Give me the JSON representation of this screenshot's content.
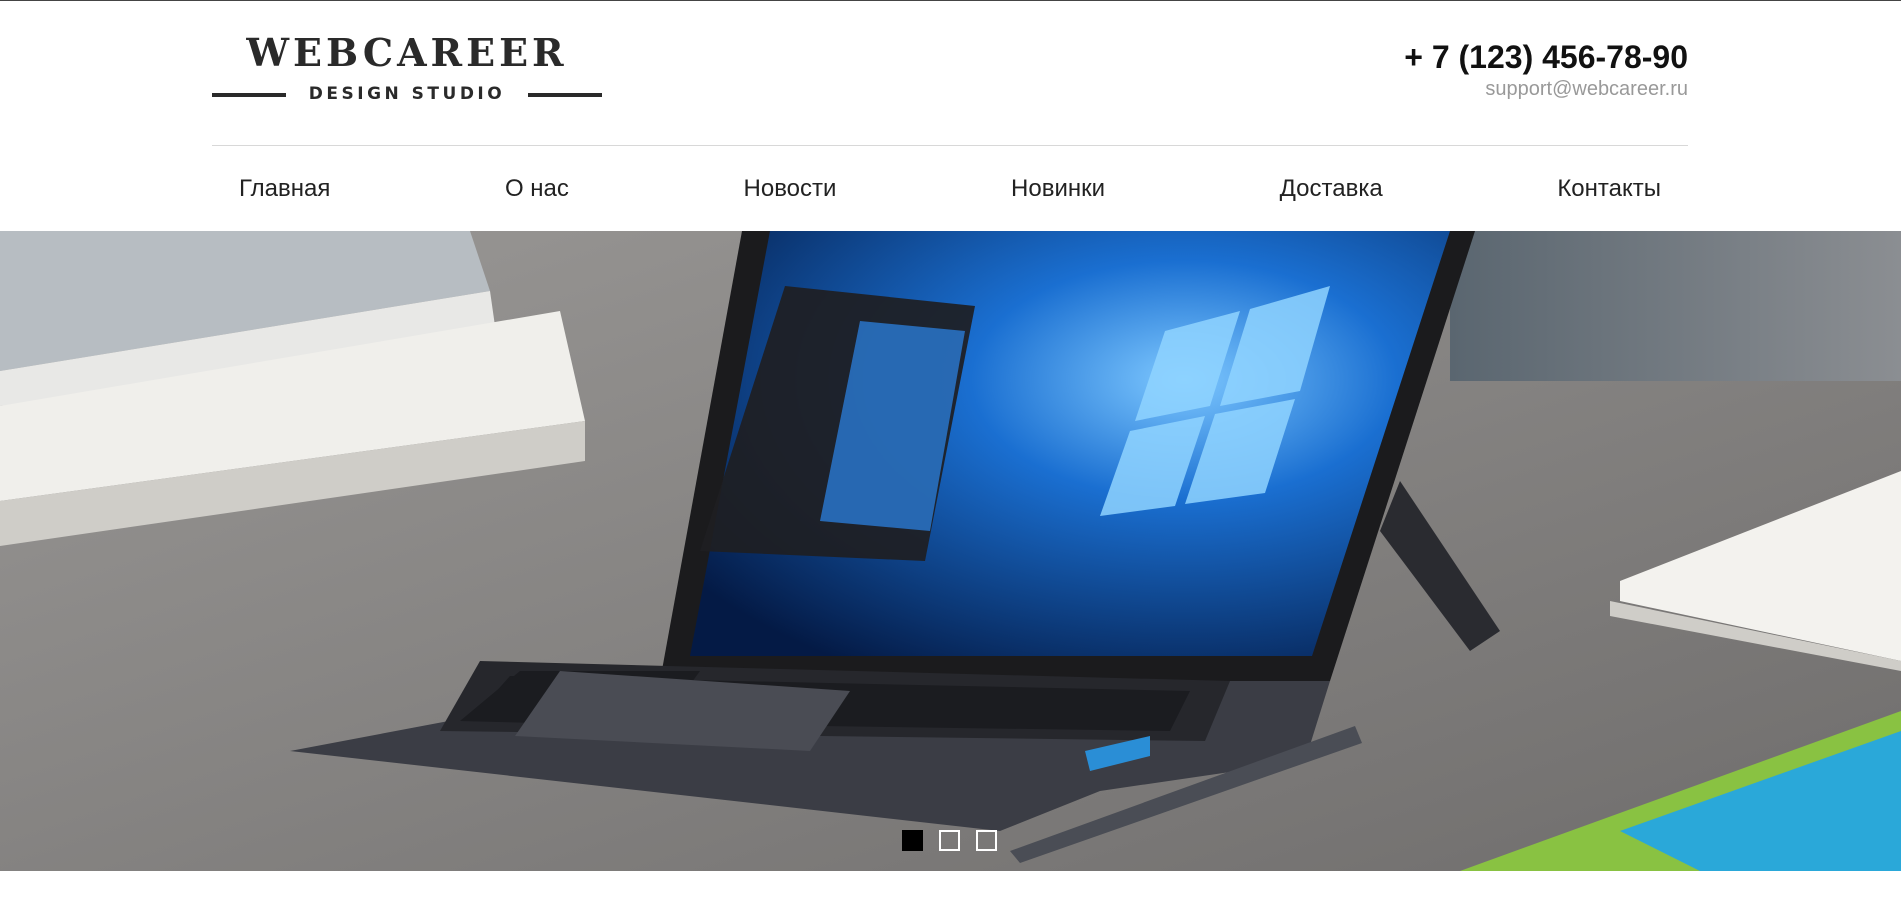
{
  "brand": {
    "title": "WEBCAREER",
    "subtitle": "DESIGN STUDIO"
  },
  "contact": {
    "phone": "+ 7 (123) 456-78-90",
    "email": "support@webcareer.ru"
  },
  "nav": {
    "items": [
      {
        "label": "Главная"
      },
      {
        "label": "О нас"
      },
      {
        "label": "Новости"
      },
      {
        "label": "Новинки"
      },
      {
        "label": "Доставка"
      },
      {
        "label": "Контакты"
      }
    ]
  },
  "slider": {
    "active_slide": 1,
    "slide_count": 3,
    "image": "laptop-on-desk-photo"
  },
  "colors": {
    "accent": "#000000",
    "text": "#222222",
    "muted": "#999999"
  }
}
